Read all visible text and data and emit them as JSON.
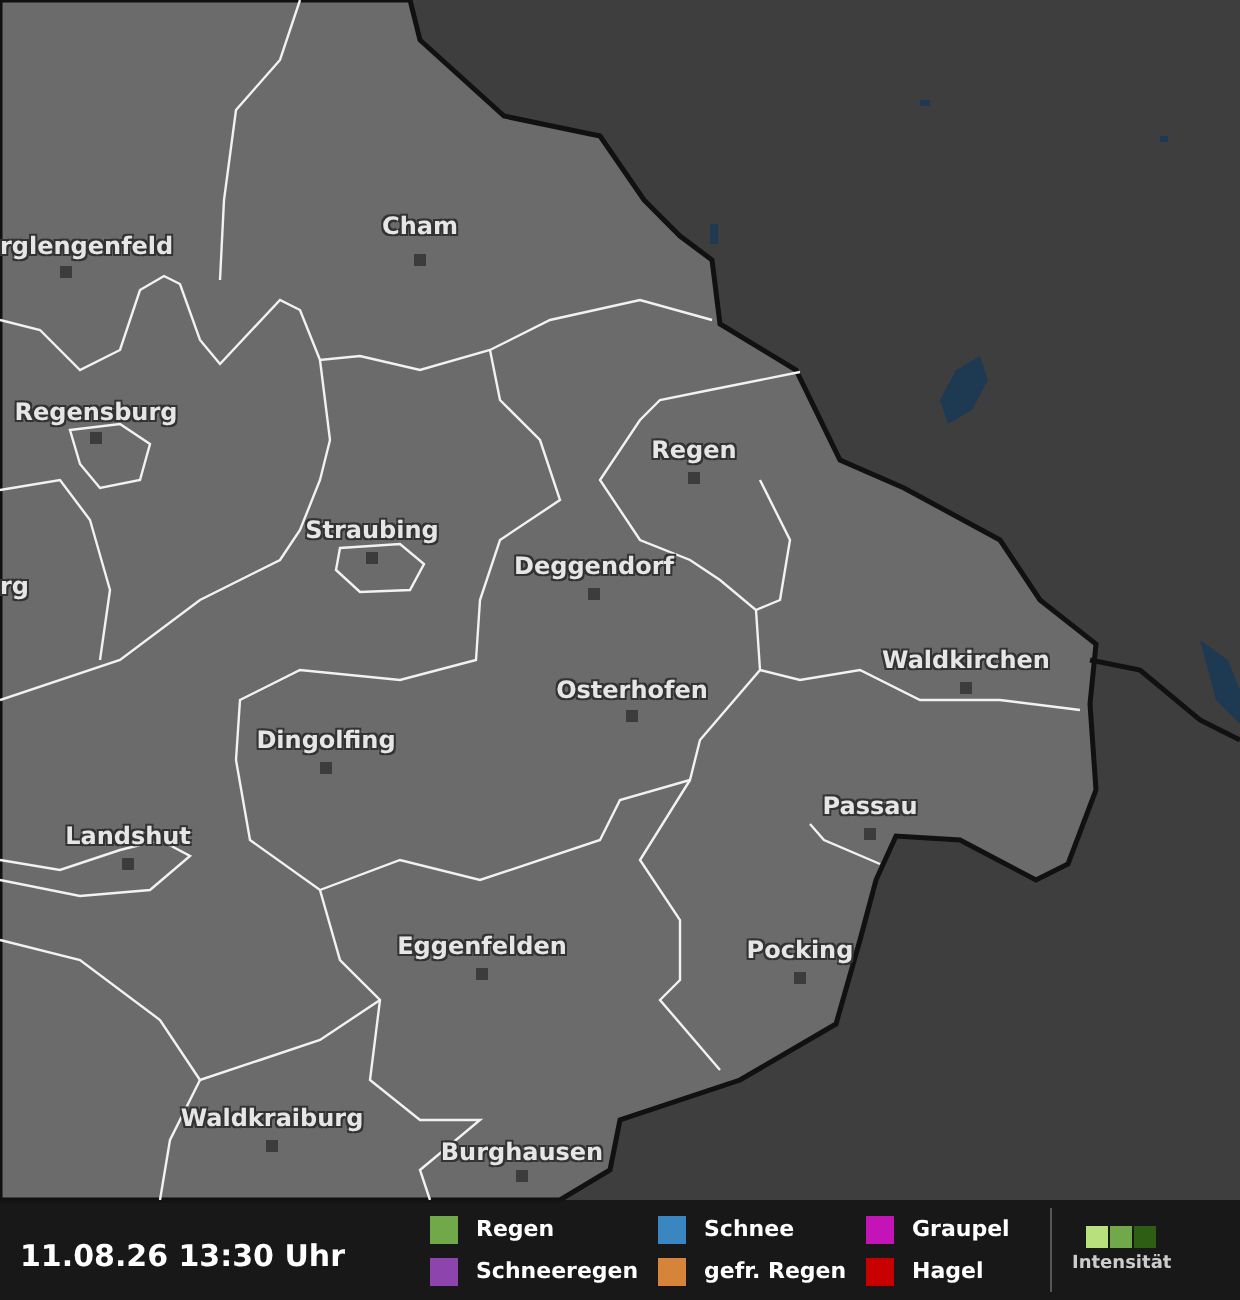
{
  "map": {
    "cities": [
      {
        "name": "rglengenfeld"
      },
      {
        "name": "Cham"
      },
      {
        "name": "Regensburg"
      },
      {
        "name": "rg"
      },
      {
        "name": "Straubing"
      },
      {
        "name": "Regen"
      },
      {
        "name": "Deggendorf"
      },
      {
        "name": "Osterhofen"
      },
      {
        "name": "Waldkirchen"
      },
      {
        "name": "Dingolfing"
      },
      {
        "name": "Landshut"
      },
      {
        "name": "Passau"
      },
      {
        "name": "Pocking"
      },
      {
        "name": "Eggenfelden"
      },
      {
        "name": "Waldkraiburg"
      },
      {
        "name": "Burghausen"
      }
    ]
  },
  "footer": {
    "timestamp": "11.08.26 13:30 Uhr",
    "legend": [
      {
        "label": "Regen",
        "color": "#70a84a"
      },
      {
        "label": "Schneeregen",
        "color": "#8e44ad"
      },
      {
        "label": "Schnee",
        "color": "#3a86c0"
      },
      {
        "label": "gefr. Regen",
        "color": "#d6843a"
      },
      {
        "label": "Graupel",
        "color": "#c414b8"
      },
      {
        "label": "Hagel",
        "color": "#c80000"
      }
    ],
    "intensity": {
      "label": "Intensität",
      "steps": [
        {
          "color": "#b8e07c"
        },
        {
          "color": "#70a84a"
        },
        {
          "color": "#2e5e14"
        }
      ]
    }
  }
}
